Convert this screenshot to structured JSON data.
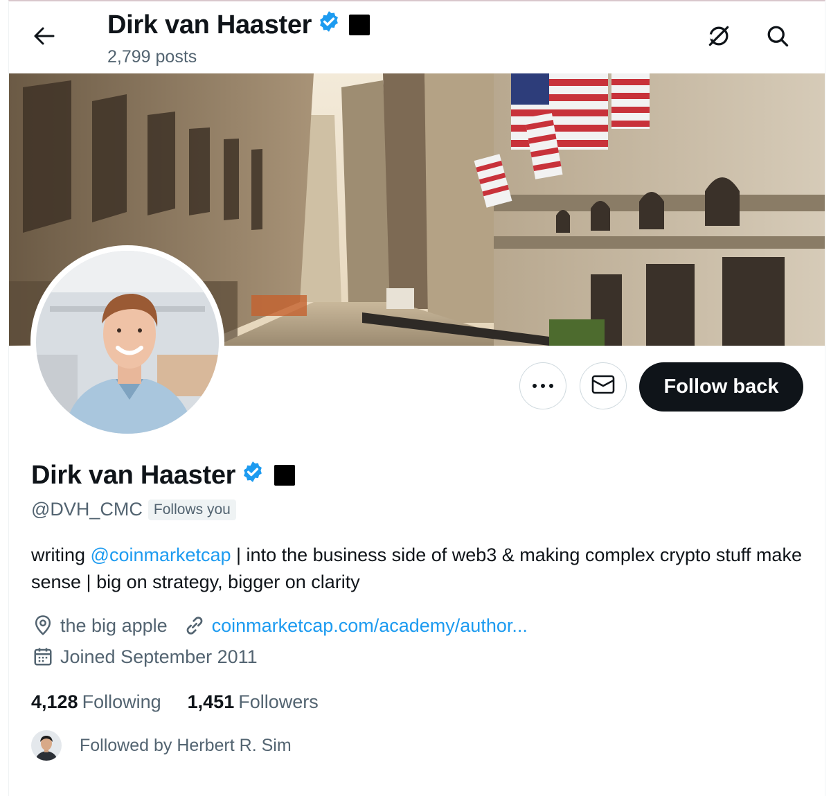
{
  "header": {
    "display_name": "Dirk van Haaster",
    "posts_count": "2,799 posts"
  },
  "icons": {
    "back": "arrow-left-icon",
    "header_action": "disconnect-icon",
    "search": "search-icon",
    "more": "more-dots-icon",
    "message": "envelope-icon",
    "verified": "verified-badge-icon",
    "location": "location-pin-icon",
    "link": "link-icon",
    "calendar": "calendar-icon"
  },
  "colors": {
    "accent": "#1d9bf0",
    "text_primary": "#0f1419",
    "text_secondary": "#536471",
    "follow_button_bg": "#0f1419"
  },
  "actions": {
    "follow_label": "Follow back"
  },
  "profile": {
    "name": "Dirk van Haaster",
    "handle": "@DVH_CMC",
    "follows_you": "Follows you",
    "bio_prefix": "writing ",
    "bio_mention": "@coinmarketcap",
    "bio_suffix": " | into the business side of web3 & making complex crypto stuff make sense | big on strategy, bigger on clarity",
    "location": "the big apple",
    "website": "coinmarketcap.com/academy/author...",
    "joined": "Joined September 2011"
  },
  "stats": {
    "following_count": "4,128",
    "following_label": "Following",
    "followers_count": "1,451",
    "followers_label": "Followers"
  },
  "followed_by": {
    "text": "Followed by Herbert R. Sim"
  }
}
